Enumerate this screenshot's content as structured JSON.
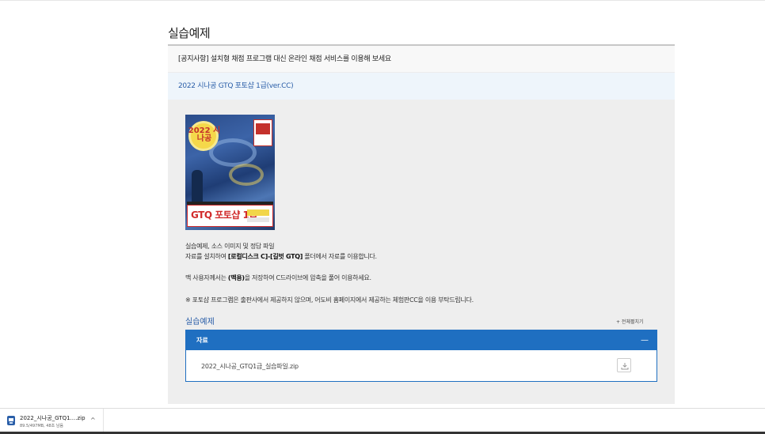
{
  "section_title": "실습예제",
  "notice_text": "[공지사항] 설치형 채점 프로그램 대신 온라인 채점 서비스를 이용해 보세요",
  "book_title": "2022 시나공 GTQ 포토샵 1급(ver.CC)",
  "cover": {
    "moon_text": "2022 시나공",
    "label_text": "GTQ 포토샵 1급"
  },
  "description": {
    "line1": "실습예제, 소스 이미지 및 정답 파일",
    "line2_prefix": "자료를 설치하여 ",
    "line2_bold": "[로컬디스크 C]-[길벗 GTQ]",
    "line2_suffix": " 폴더에서 자료를 이용합니다.",
    "line3_prefix": "맥 사용자께서는 ",
    "line3_bold": "(맥용)",
    "line3_suffix": "을 저장하여 C드라이브에 압축을 풀어 이용하세요.",
    "line4": "※ 포토샵 프로그램은 출판사에서 제공하지 않으며, 어도비 홈페이지에서 제공하는 체험판CC을 이용 부탁드립니다."
  },
  "subsection_title": "실습예제",
  "collapse_all_label": "+ 전체펼치기",
  "file_section": {
    "header_label": "자료",
    "toggle_symbol": "—",
    "file_name": "2022_시나공_GTQ1급_실습파일.zip"
  },
  "download_bar": {
    "file_name": "2022_시나공_GTQ1....zip",
    "status": "89.5/497MB, 48초 남음",
    "chevron": "^"
  },
  "colors": {
    "accent_blue": "#1f6fc1",
    "link_blue": "#2a5ea8",
    "panel_gray": "#eeeeee"
  }
}
